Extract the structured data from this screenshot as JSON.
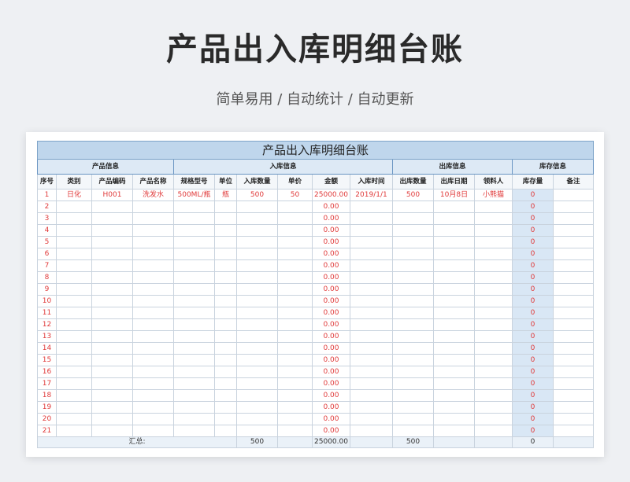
{
  "page": {
    "title": "产品出入库明细台账",
    "subtitle": "简单易用 / 自动统计 / 自动更新"
  },
  "sheet": {
    "title": "产品出入库明细台账",
    "groups": {
      "product": "产品信息",
      "inbound": "入库信息",
      "outbound": "出库信息",
      "stock": "库存信息"
    },
    "headers": {
      "seq": "序号",
      "category": "类别",
      "code": "产品编码",
      "name": "产品名称",
      "spec": "规格型号",
      "unit": "单位",
      "in_qty": "入库数量",
      "price": "单价",
      "amount": "金额",
      "in_date": "入库时间",
      "out_qty": "出库数量",
      "out_date": "出库日期",
      "receiver": "领料人",
      "stock": "库存量",
      "note": "备注"
    },
    "first_row": {
      "seq": "1",
      "category": "日化",
      "code": "H001",
      "name": "洗发水",
      "spec": "500ML/瓶",
      "unit": "瓶",
      "in_qty": "500",
      "price": "50",
      "amount": "25000.00",
      "in_date": "2019/1/1",
      "out_qty": "500",
      "out_date": "10月8日",
      "receiver": "小熊猫",
      "stock": "0",
      "note": ""
    },
    "empty_rows": [
      {
        "seq": "2",
        "amount": "0.00",
        "stock": "0"
      },
      {
        "seq": "3",
        "amount": "0.00",
        "stock": "0"
      },
      {
        "seq": "4",
        "amount": "0.00",
        "stock": "0"
      },
      {
        "seq": "5",
        "amount": "0.00",
        "stock": "0"
      },
      {
        "seq": "6",
        "amount": "0.00",
        "stock": "0"
      },
      {
        "seq": "7",
        "amount": "0.00",
        "stock": "0"
      },
      {
        "seq": "8",
        "amount": "0.00",
        "stock": "0"
      },
      {
        "seq": "9",
        "amount": "0.00",
        "stock": "0"
      },
      {
        "seq": "10",
        "amount": "0.00",
        "stock": "0"
      },
      {
        "seq": "11",
        "amount": "0.00",
        "stock": "0"
      },
      {
        "seq": "12",
        "amount": "0.00",
        "stock": "0"
      },
      {
        "seq": "13",
        "amount": "0.00",
        "stock": "0"
      },
      {
        "seq": "14",
        "amount": "0.00",
        "stock": "0"
      },
      {
        "seq": "15",
        "amount": "0.00",
        "stock": "0"
      },
      {
        "seq": "16",
        "amount": "0.00",
        "stock": "0"
      },
      {
        "seq": "17",
        "amount": "0.00",
        "stock": "0"
      },
      {
        "seq": "18",
        "amount": "0.00",
        "stock": "0"
      },
      {
        "seq": "19",
        "amount": "0.00",
        "stock": "0"
      },
      {
        "seq": "20",
        "amount": "0.00",
        "stock": "0"
      },
      {
        "seq": "21",
        "amount": "0.00",
        "stock": "0"
      }
    ],
    "total_row": {
      "label": "汇总:",
      "in_qty": "500",
      "amount": "25000.00",
      "out_qty": "500",
      "stock": "0"
    }
  },
  "colors": {
    "title_band": "#bfd6ec",
    "stock_column": "#d9e7f5",
    "data_text": "#e03a3a"
  }
}
